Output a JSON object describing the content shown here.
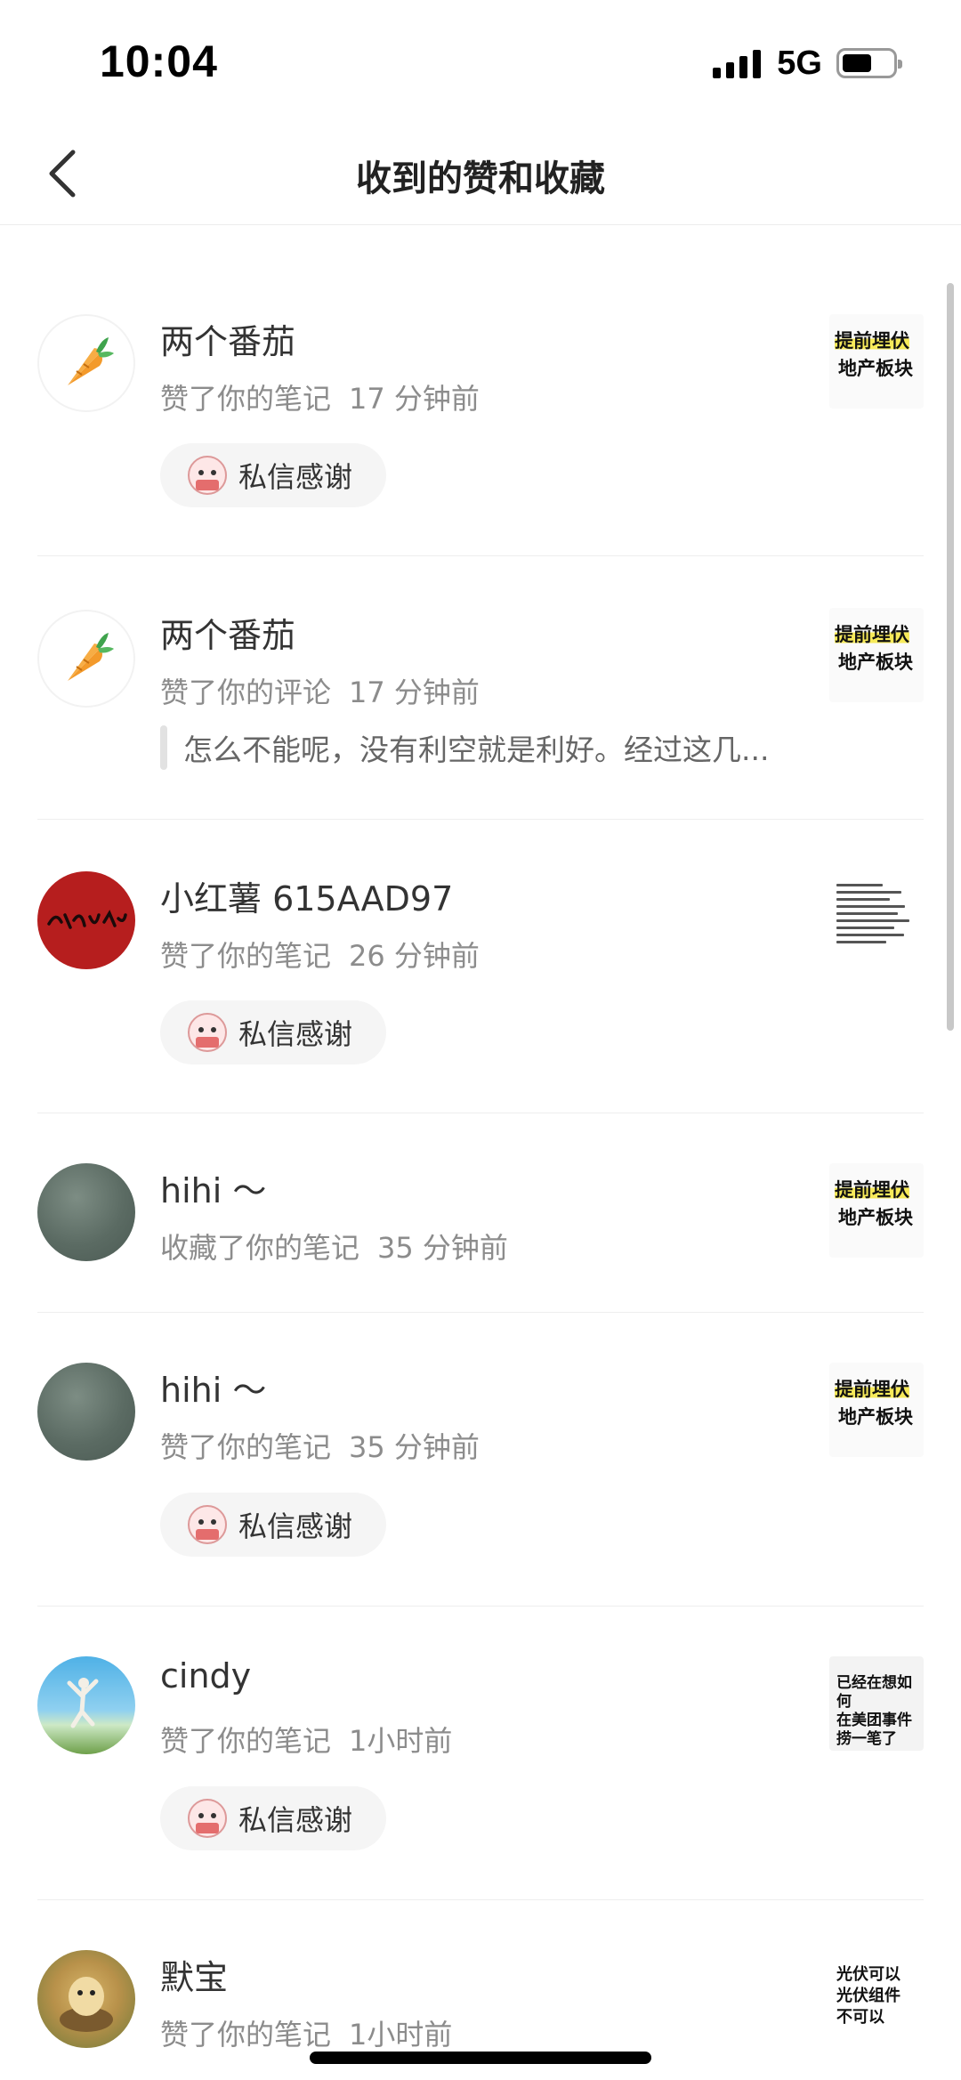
{
  "status_bar": {
    "time": "10:04",
    "network": "5G"
  },
  "header": {
    "title": "收到的赞和收藏"
  },
  "thank_label": "私信感谢",
  "items": [
    {
      "nick": "两个番茄",
      "action": "赞了你的笔记",
      "time": "17 分钟前",
      "avatar": "carrot-icon",
      "thumb_line1": "提前埋伏",
      "thumb_line2": "地产板块"
    },
    {
      "nick": "两个番茄",
      "action": "赞了你的评论",
      "time": "17 分钟前",
      "avatar": "carrot-icon",
      "quote": "怎么不能呢，没有利空就是利好。经过这几...",
      "thumb_line1": "提前埋伏",
      "thumb_line2": "地产板块"
    },
    {
      "nick": "小红薯 615AAD97",
      "action": "赞了你的笔记",
      "time": "26 分钟前",
      "avatar": "calligraphy-avatar"
    },
    {
      "nick": "hihi ～",
      "action": "收藏了你的笔记",
      "time": "35 分钟前",
      "avatar": "water-avatar",
      "thumb_line1": "提前埋伏",
      "thumb_line2": "地产板块"
    },
    {
      "nick": "hihi ～",
      "action": "赞了你的笔记",
      "time": "35 分钟前",
      "avatar": "water-avatar",
      "thumb_line1": "提前埋伏",
      "thumb_line2": "地产板块"
    },
    {
      "nick": "cindy",
      "action": "赞了你的笔记",
      "time": "1小时前",
      "avatar": "sky-avatar",
      "thumb_text": "已经在想如何\n在美团事件\n捞一笔了"
    },
    {
      "nick": "默宝",
      "action": "赞了你的笔记",
      "time": "1小时前",
      "avatar": "hamster-avatar",
      "thumb_text": "光伏可以\n光伏组件\n不可以"
    }
  ]
}
